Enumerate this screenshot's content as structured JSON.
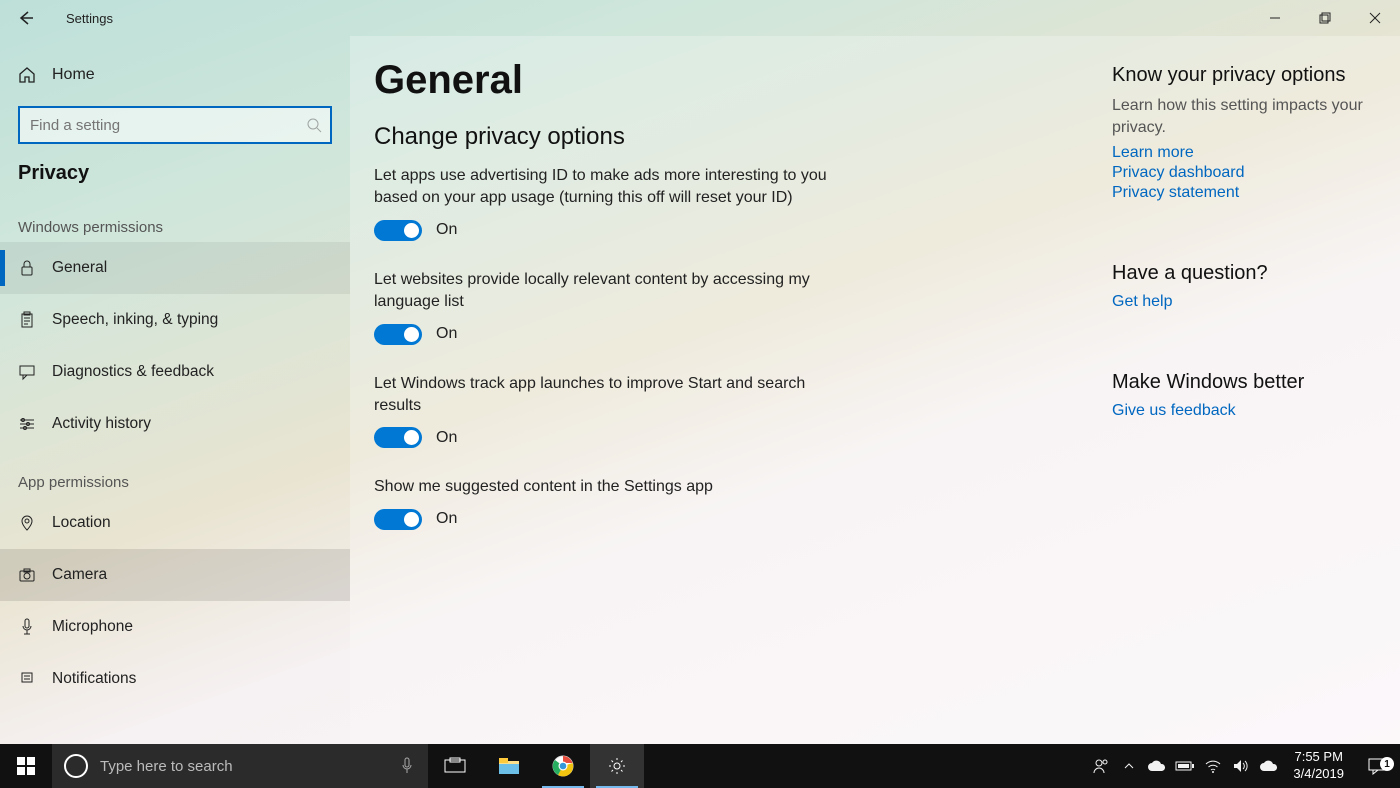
{
  "app": {
    "title": "Settings"
  },
  "sidebar": {
    "home_label": "Home",
    "search_placeholder": "Find a setting",
    "category": "Privacy",
    "group1": "Windows permissions",
    "group2": "App permissions",
    "win_perms": [
      {
        "label": "General"
      },
      {
        "label": "Speech, inking, & typing"
      },
      {
        "label": "Diagnostics & feedback"
      },
      {
        "label": "Activity history"
      }
    ],
    "app_perms": [
      {
        "label": "Location"
      },
      {
        "label": "Camera"
      },
      {
        "label": "Microphone"
      },
      {
        "label": "Notifications"
      }
    ]
  },
  "main": {
    "title": "General",
    "subhead": "Change privacy options",
    "settings": [
      {
        "desc": "Let apps use advertising ID to make ads more interesting to you based on your app usage (turning this off will reset your ID)",
        "state": "On"
      },
      {
        "desc": "Let websites provide locally relevant content by accessing my language list",
        "state": "On"
      },
      {
        "desc": "Let Windows track app launches to improve Start and search results",
        "state": "On"
      },
      {
        "desc": "Show me suggested content in the Settings app",
        "state": "On"
      }
    ]
  },
  "right": {
    "block1_head": "Know your privacy options",
    "block1_text": "Learn how this setting impacts your privacy.",
    "links1": [
      "Learn more",
      "Privacy dashboard",
      "Privacy statement"
    ],
    "block2_head": "Have a question?",
    "link2": "Get help",
    "block3_head": "Make Windows better",
    "link3": "Give us feedback"
  },
  "taskbar": {
    "search_placeholder": "Type here to search",
    "time": "7:55 PM",
    "date": "3/4/2019",
    "action_badge": "1"
  }
}
